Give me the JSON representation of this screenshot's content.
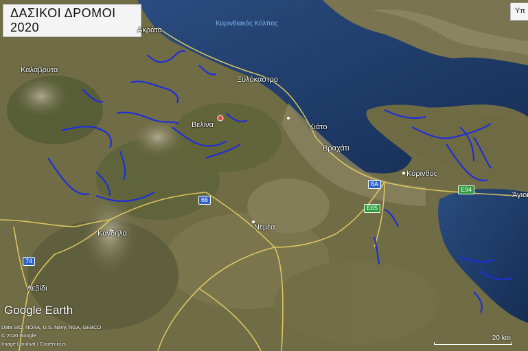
{
  "title": "ΔΑΣΙΚΟΙ ΔΡΟΜΟΙ 2020",
  "corner_label": "Υπ",
  "places": {
    "kalavryta": "Καλάβρυτα",
    "akrata": "Ακράτα",
    "xylokastro": "Ξυλόκαστρο",
    "velina": "Βελίνα",
    "kiato": "Κιάτο",
    "vrachati": "Βραχάτι",
    "korinthos": "Κόρινθος",
    "agioi": "Άγιοι",
    "kandila": "Κανδήλα",
    "nemea": "Νεμέα",
    "levidi": "Λεβίδι"
  },
  "sea_label": "Κορινθιακός Κόλπος",
  "roads": {
    "r66": "66",
    "e65": "E65",
    "r74": "74",
    "r8a": "8A",
    "e94": "E94"
  },
  "branding": "Google Earth",
  "credits": [
    "Data SIO, NOAA, U.S. Navy, NGA, GEBCO",
    "© 2020 Google",
    "Image Landsat / Copernicus"
  ],
  "scale_label": "20 km",
  "colors": {
    "forest_roads": "#1f2fd6",
    "main_roads": "#e7cf62",
    "sea": "#1e3a66"
  }
}
